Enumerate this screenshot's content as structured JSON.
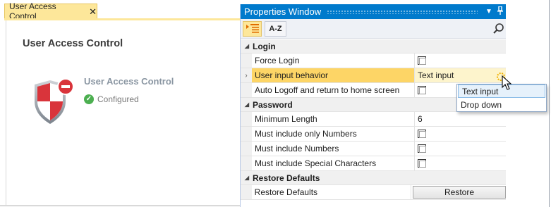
{
  "document": {
    "tab_label": "User Access Control",
    "tab_close": "✕",
    "page_title": "User Access Control",
    "module_name": "User Access Control",
    "module_status": "Configured"
  },
  "properties": {
    "window_title": "Properties Window",
    "pin_glyph": "▾",
    "pin2_glyph": "📌",
    "az_label": "A-Z",
    "categories": [
      {
        "name": "Login",
        "rows": [
          {
            "label": "Force Login",
            "type": "checkbox",
            "checked": false
          },
          {
            "label": "User input behavior",
            "type": "dropdown",
            "value": "Text input",
            "selected": true
          },
          {
            "label": "Auto Logoff and return to home screen",
            "type": "checkbox",
            "checked": false
          }
        ]
      },
      {
        "name": "Password",
        "rows": [
          {
            "label": "Minimum Length",
            "type": "text",
            "value": "6"
          },
          {
            "label": "Must include only Numbers",
            "type": "checkbox",
            "checked": false
          },
          {
            "label": "Must include Numbers",
            "type": "checkbox",
            "checked": false
          },
          {
            "label": "Must include Special Characters",
            "type": "checkbox",
            "checked": false
          }
        ]
      },
      {
        "name": "Restore Defaults",
        "rows": [
          {
            "label": "Restore Defaults",
            "type": "button",
            "value": "Restore"
          }
        ]
      }
    ],
    "dropdown_options": [
      "Text input",
      "Drop down"
    ],
    "highlighted_option": "Text input"
  },
  "colors": {
    "title_bar": "#007acc",
    "tab_active": "#fde79a",
    "selected_row": "#fdd566",
    "status_ok": "#4caf50",
    "shield_red": "#d9343b"
  }
}
